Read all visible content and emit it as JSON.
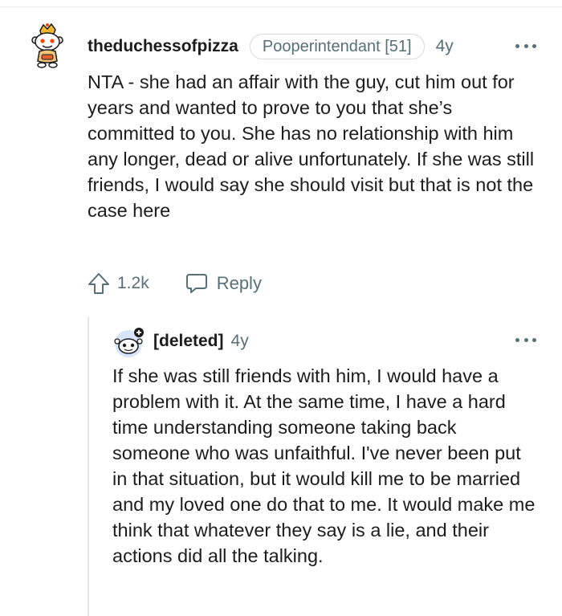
{
  "parent_comment": {
    "username": "theduchessofpizza",
    "flair": "Pooperintendant [51]",
    "age": "4y",
    "body": "NTA - she had an affair with the guy, cut him out for years and wanted to prove to you that she’s committed to you. She has no relationship with him any longer, dead or alive unfortunately. If she was still friends, I would say she should visit but that is not the case here",
    "votes": "1.2k",
    "reply_label": "Reply",
    "avatar_icon": "snoo-avatar-icon"
  },
  "reply_comment": {
    "username": "[deleted]",
    "age": "4y",
    "body": "If she was still friends with him, I would have a problem with it. At the same time, I have a hard time understanding someone taking back someone who was unfaithful. I've never been put in that situation, but it would kill me to be married and my loved one do that to me. It would make me think that whatever they say is a lie, and their actions did all the talking.",
    "avatar_icon": "deleted-user-avatar-icon"
  },
  "colors": {
    "text": "#1c1c1c",
    "meta": "#576f76",
    "border": "#d7dadc",
    "thread_line": "#e4e6e8"
  }
}
